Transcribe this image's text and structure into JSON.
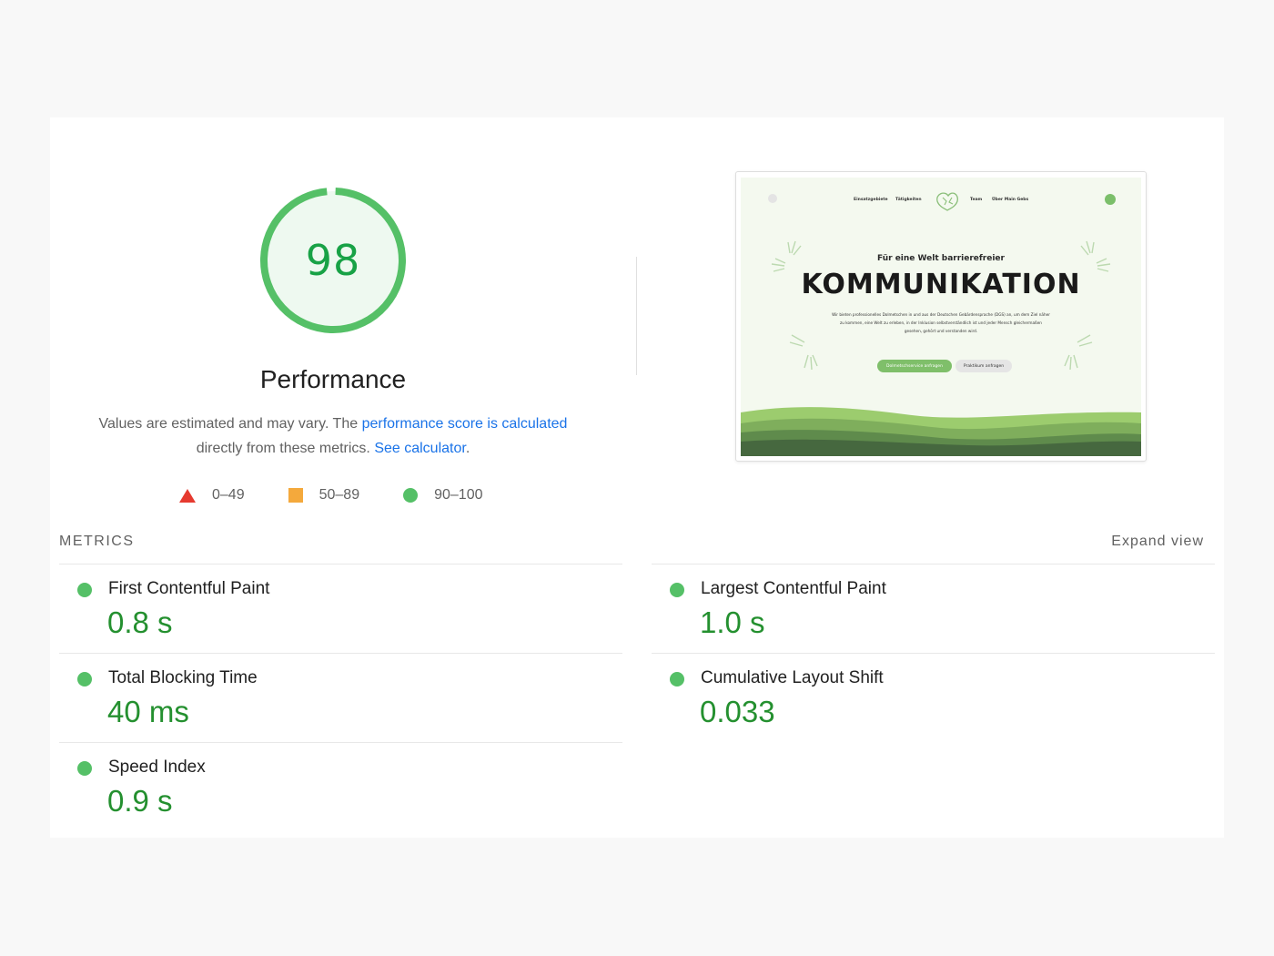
{
  "performance": {
    "score": "98",
    "title": "Performance",
    "description_prefix": "Values are estimated and may vary. The ",
    "link_score": "performance score is calculated",
    "description_middle": " directly from these metrics. ",
    "link_calculator": "See calculator",
    "description_suffix": "."
  },
  "legend": [
    {
      "range": "0–49",
      "shape": "triangle",
      "color": "#e63a2f"
    },
    {
      "range": "50–89",
      "shape": "square",
      "color": "#f4a93c"
    },
    {
      "range": "90–100",
      "shape": "circle",
      "color": "#55c067"
    }
  ],
  "thumbnail": {
    "nav": [
      "Einsatzgebiete",
      "Tätigkeiten",
      "Team",
      "Über Main Gebs"
    ],
    "kicker": "Für eine Welt barrierefreier",
    "headline": "KOMMUNIKATION",
    "body": "Wir bieten professionelles Dolmetschen in und aus der Deutschen Gebärdensprache (DGS) an, um dem Ziel näher zu kommen, eine Welt zu erleben, in der Inklusion selbstverständlich ist und jeder Mensch gleichermaßen gesehen, gehört und verstanden wird.",
    "button_primary": "Dolmetschservice anfragen",
    "button_secondary": "Praktikum anfragen"
  },
  "metrics": {
    "header": "METRICS",
    "expand_label": "Expand view",
    "items": [
      {
        "label": "First Contentful Paint",
        "value": "0.8 s",
        "status": "good"
      },
      {
        "label": "Largest Contentful Paint",
        "value": "1.0 s",
        "status": "good"
      },
      {
        "label": "Total Blocking Time",
        "value": "40 ms",
        "status": "good"
      },
      {
        "label": "Cumulative Layout Shift",
        "value": "0.033",
        "status": "good"
      },
      {
        "label": "Speed Index",
        "value": "0.9 s",
        "status": "good"
      }
    ]
  },
  "colors": {
    "pass": "#55c067",
    "pass_text": "#24902f",
    "link": "#1a73e8",
    "gauge_fill": "#eef9f0"
  }
}
